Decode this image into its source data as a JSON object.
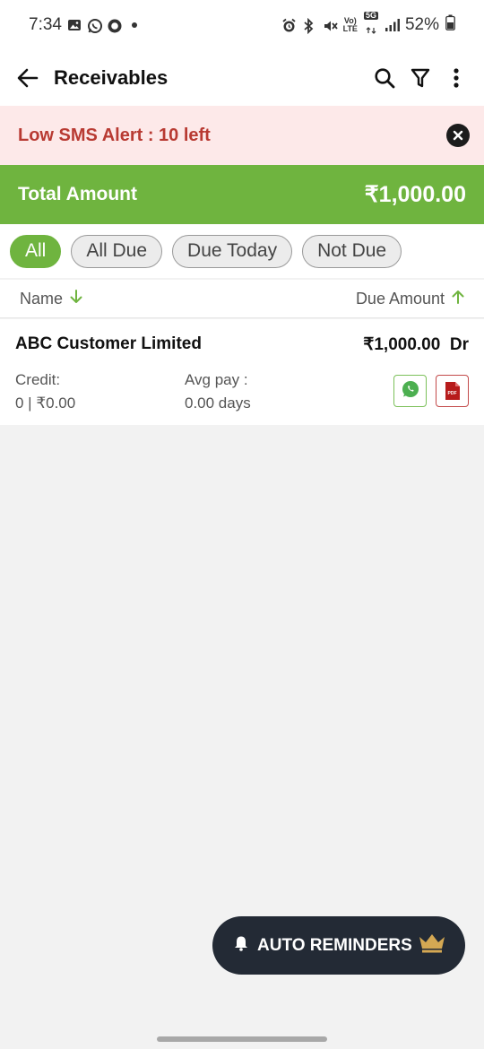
{
  "status_bar": {
    "time": "7:34",
    "volte": "Vo)",
    "lte": "LTE",
    "five_g": "5G",
    "battery": "52%"
  },
  "app_bar": {
    "title": "Receivables",
    "icons": [
      "back-arrow-icon",
      "search-icon",
      "filter-icon",
      "more-vertical-icon"
    ]
  },
  "alert": {
    "text": "Low SMS Alert : 10 left",
    "color": "#b83a32",
    "background": "#fde9e9"
  },
  "total": {
    "label": "Total Amount",
    "value": "₹1,000.00",
    "background": "#6fb43f"
  },
  "filters": [
    {
      "label": "All",
      "active": true
    },
    {
      "label": "All Due",
      "active": false
    },
    {
      "label": "Due Today",
      "active": false
    },
    {
      "label": "Not Due",
      "active": false
    }
  ],
  "columns": {
    "name": "Name",
    "due_amount": "Due Amount"
  },
  "rows": [
    {
      "name": "ABC Customer Limited",
      "amount": "₹1,000.00  Dr",
      "credit_label": "Credit:",
      "credit_value": "0 | ₹0.00",
      "avg_label": "Avg pay :",
      "avg_value": "0.00 days",
      "pdf_label": "PDF"
    }
  ],
  "fab": {
    "label": "AUTO REMINDERS",
    "icons": [
      "bell-icon",
      "crown-icon"
    ],
    "background": "#232a35"
  },
  "colors": {
    "accent_green": "#6fb43f",
    "whatsapp_green": "#4caf50",
    "pdf_red": "#b71c1c",
    "crown_gold": "#d4a853"
  }
}
